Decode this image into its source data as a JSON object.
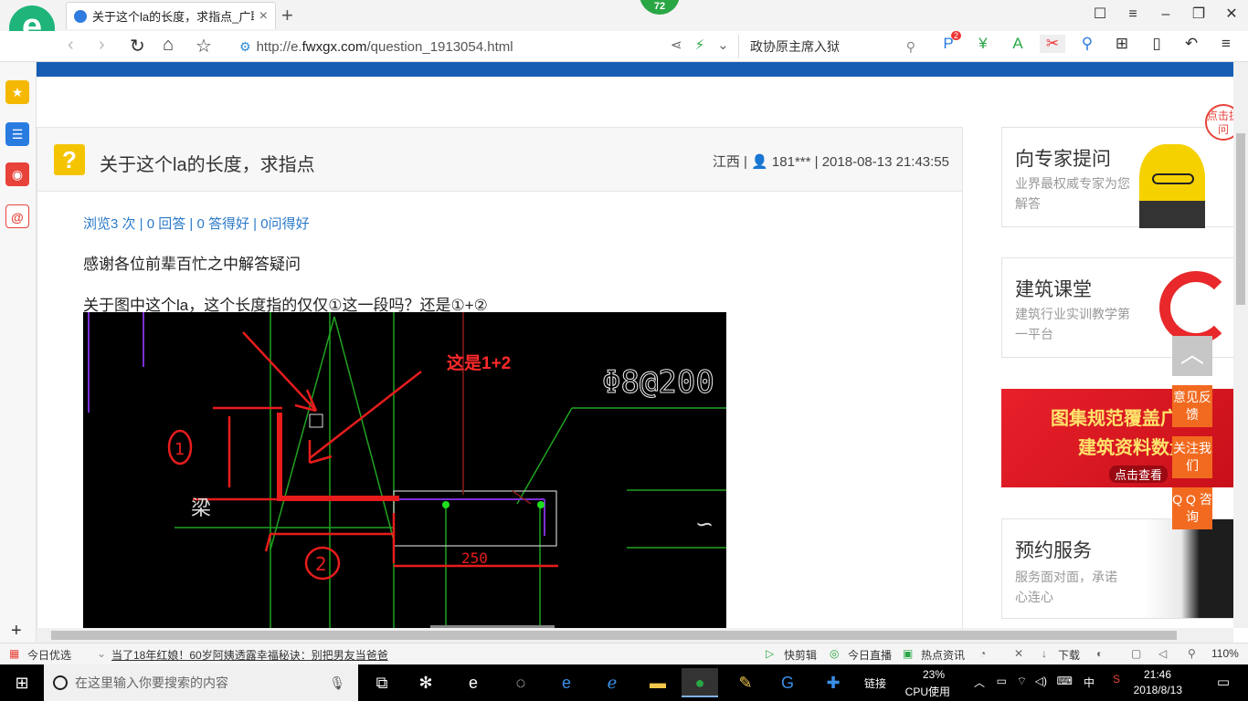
{
  "browser": {
    "tab_title": "关于这个la的长度，求指点_广联",
    "new_tab": "+",
    "score_badge": "72",
    "url_prefix": "http://e.",
    "url_domain": "fwxgx.com",
    "url_path": "/question_1913054.html",
    "search_text": "政协原主席入狱",
    "ext_badge": "2"
  },
  "question": {
    "title": "关于这个la的长度，求指点",
    "region": "江西",
    "user": "181***",
    "datetime": "2018-08-13 21:43:55",
    "stats": {
      "views": "浏览3 次",
      "answers": "0 回答",
      "good_answers": "0 答得好",
      "good_questions": "0问得好"
    },
    "body_line1": "感谢各位前辈百忙之中解答疑问",
    "body_line2": "关于图中这个la，这个长度指的仅仅①这一段吗？还是①+②"
  },
  "drawing": {
    "annotation": "这是1+2",
    "rebar_label": "Φ8@200",
    "dimension": "250",
    "beam_label": "梁"
  },
  "sidebar_cards": {
    "expert_title": "向专家提问",
    "expert_sub": "业界最权威专家为您解答",
    "expert_bubble": "点击提问",
    "class_title": "建筑课堂",
    "class_sub": "建筑行业实训教学第一平台",
    "banner_line1": "图集规范覆盖广",
    "banner_line2": "建筑资料数量",
    "banner_btn": "点击查看",
    "appoint_title": "预约服务",
    "appoint_sub": "服务面对面，承诺心连心"
  },
  "float_buttons": {
    "to_top": "︿",
    "feedback": "意见反馈",
    "follow": "关注我们",
    "qq": "Q Q 咨询"
  },
  "statusbar": {
    "today": "今日优选",
    "headline": "当了18年红娘！60岁阿姨透露幸福秘诀：别把男友当爸爸",
    "quick_cut": "快剪辑",
    "live": "今日直播",
    "news": "热点资讯",
    "download": "下载",
    "zoom": "110%"
  },
  "taskbar": {
    "search_placeholder": "在这里输入你要搜索的内容",
    "links": "链接",
    "cpu_percent": "23%",
    "cpu_label": "CPU使用",
    "ime": "中",
    "time": "21:46",
    "date": "2018/8/13"
  },
  "colors": {
    "brand_blue": "#155eb4",
    "accent_orange": "#f26a1f",
    "question_yellow": "#f5c400",
    "link_blue": "#2b7ac9"
  }
}
